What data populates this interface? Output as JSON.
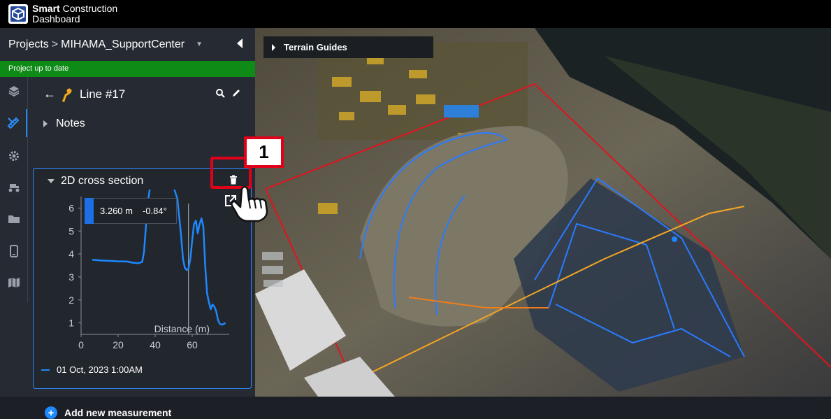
{
  "app": {
    "brand_line1_bold": "Smart",
    "brand_line1_rest": " Construction",
    "brand_line2": "Dashboard"
  },
  "breadcrumb": {
    "projects": "Projects",
    "separator": ">",
    "project": "MIHAMA_SupportCenter"
  },
  "status": {
    "text": "Project up to date",
    "color": "#0e8a16"
  },
  "rail": {
    "items": [
      "layers-icon",
      "measure-tools-icon",
      "settings-gear-icon",
      "machine-icon",
      "folder-icon",
      "device-icon",
      "map-icon"
    ],
    "active_index": 1
  },
  "panel": {
    "title": "Line #17",
    "notes_label": "Notes",
    "section_title": "2D cross section",
    "tooltip_distance": "3.260 m",
    "tooltip_angle": "-0.84°",
    "legend_label": "01 Oct, 2023 1:00AM",
    "add_label": "Add new measurement"
  },
  "chart_data": {
    "type": "line",
    "xlabel": "Distance (m)",
    "ylabel": "",
    "xlim": [
      0,
      80
    ],
    "ylim": [
      0.5,
      6.5
    ],
    "x_ticks": [
      "0",
      "20",
      "40",
      "60"
    ],
    "y_ticks": [
      "1",
      "2",
      "3",
      "4",
      "5",
      "6"
    ],
    "series": [
      {
        "name": "01 Oct, 2023 1:00AM",
        "color": "#1e88ff",
        "x": [
          6,
          10,
          15,
          20,
          25,
          28,
          31,
          33,
          34,
          35,
          36,
          37,
          38,
          40,
          42,
          44,
          46,
          48,
          50,
          52,
          54,
          55,
          56,
          57,
          58,
          59,
          60,
          61,
          62,
          63,
          64,
          65,
          66,
          67,
          68,
          69,
          70,
          71,
          72,
          73,
          74,
          75,
          76,
          77,
          78
        ],
        "y": [
          3.75,
          3.72,
          3.7,
          3.68,
          3.67,
          3.62,
          3.6,
          3.65,
          4.1,
          5.2,
          6.2,
          6.8,
          7.2,
          7.4,
          7.3,
          7.2,
          7.3,
          7.1,
          6.9,
          6.4,
          4.8,
          3.8,
          3.4,
          3.3,
          3.35,
          3.8,
          4.6,
          5.3,
          5.45,
          4.9,
          5.3,
          5.55,
          5.2,
          3.5,
          2.3,
          1.9,
          1.6,
          1.8,
          1.7,
          1.5,
          1.1,
          0.95,
          0.92,
          0.95,
          1.0
        ]
      }
    ],
    "cursor_x": 58
  },
  "map": {
    "terrain_label": "Terrain Guides",
    "callout_number": "1"
  }
}
